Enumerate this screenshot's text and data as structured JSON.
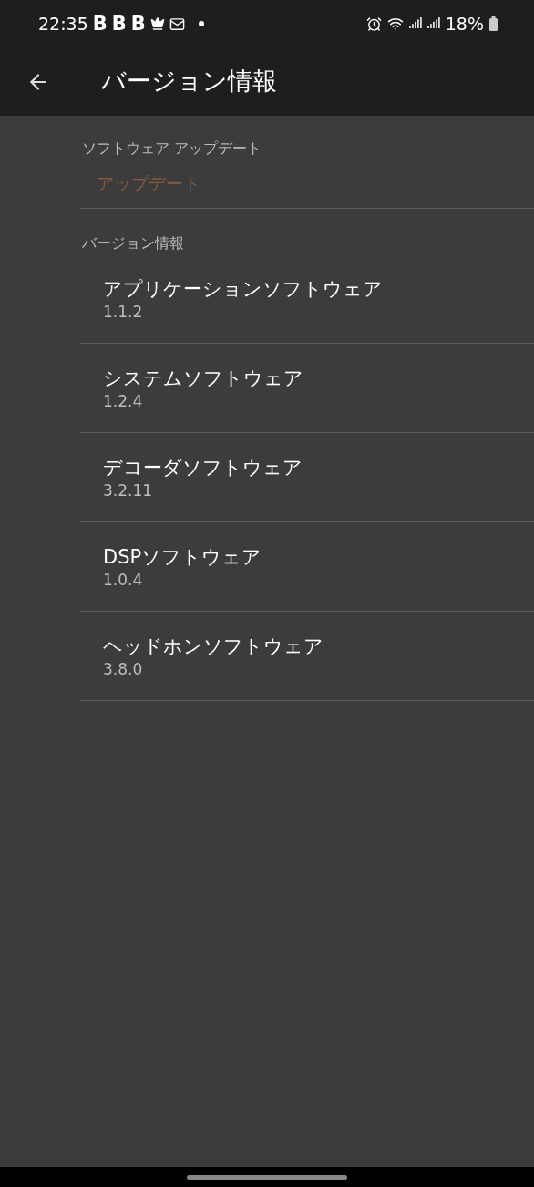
{
  "status_bar": {
    "time": "22:35",
    "notification_letters": [
      "B",
      "B",
      "B"
    ],
    "battery": "18%"
  },
  "app_bar": {
    "title": "バージョン情報"
  },
  "sections": [
    {
      "header": "ソフトウェア アップデート",
      "items": [
        {
          "kind": "action",
          "title": "アップデート",
          "disabled": true
        }
      ]
    },
    {
      "header": "バージョン情報",
      "items": [
        {
          "kind": "info",
          "title": "アプリケーションソフトウェア",
          "value": "1.1.2"
        },
        {
          "kind": "info",
          "title": "システムソフトウェア",
          "value": "1.2.4"
        },
        {
          "kind": "info",
          "title": "デコーダソフトウェア",
          "value": "3.2.11"
        },
        {
          "kind": "info",
          "title": "DSPソフトウェア",
          "value": "1.0.4"
        },
        {
          "kind": "info",
          "title": "ヘッドホンソフトウェア",
          "value": "3.8.0"
        }
      ]
    }
  ]
}
